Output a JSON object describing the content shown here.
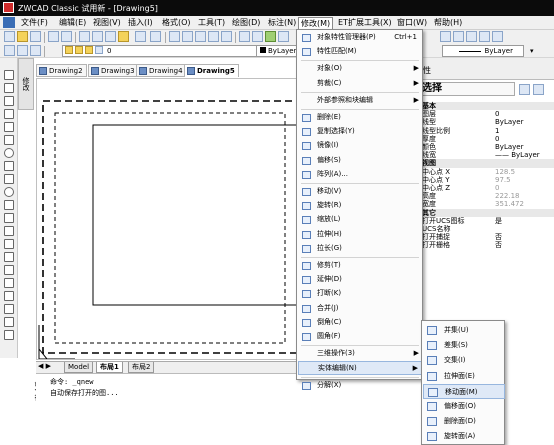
{
  "window": {
    "title": "ZWCAD Classic 试用新 - [Drawing5]"
  },
  "menubar": [
    {
      "label": "文件(F)"
    },
    {
      "label": "编辑(E)"
    },
    {
      "label": "视图(V)"
    },
    {
      "label": "插入(I)"
    },
    {
      "label": "格式(O)"
    },
    {
      "label": "工具(T)"
    },
    {
      "label": "绘图(D)"
    },
    {
      "label": "标注(N)"
    },
    {
      "label": "修改(M)"
    },
    {
      "label": "ET扩展工具(X)"
    },
    {
      "label": "窗口(W)"
    },
    {
      "label": "帮助(H)"
    }
  ],
  "toolbar": {
    "layer_value": "0",
    "color_value": "ByLayer",
    "linetype_value": "ByLayer"
  },
  "side_panel_tab": "修改",
  "doc_tabs": [
    {
      "label": "Drawing2"
    },
    {
      "label": "Drawing3"
    },
    {
      "label": "Drawing4"
    },
    {
      "label": "Drawing5"
    }
  ],
  "model_tabs": [
    {
      "label": "Model"
    },
    {
      "label": "布局1"
    },
    {
      "label": "布局2"
    }
  ],
  "command": {
    "side_label": "命令行",
    "lines": [
      "命令: _qnew",
      "自动保存打开的图..."
    ]
  },
  "properties": {
    "header": "性",
    "selection": "选择",
    "rows": [
      {
        "k": "基本",
        "v": "",
        "section": true
      },
      {
        "k": "图层",
        "v": "0"
      },
      {
        "k": "线型",
        "v": "ByLayer"
      },
      {
        "k": "线型比例",
        "v": "1"
      },
      {
        "k": "厚度",
        "v": "0"
      },
      {
        "k": "颜色",
        "v": "ByLayer"
      },
      {
        "k": "线宽",
        "v": "—— ByLayer"
      },
      {
        "k": "视图",
        "v": "",
        "section": true
      },
      {
        "k": "中心点 X",
        "v": "128.5",
        "dim": true
      },
      {
        "k": "中心点 Y",
        "v": "97.5",
        "dim": true
      },
      {
        "k": "中心点 Z",
        "v": "0",
        "dim": true
      },
      {
        "k": "高度",
        "v": "222.18",
        "dim": true
      },
      {
        "k": "宽度",
        "v": "351.472",
        "dim": true
      },
      {
        "k": "其它",
        "v": "",
        "section": true
      },
      {
        "k": "打开UCS图标",
        "v": "是"
      },
      {
        "k": "UCS名称",
        "v": ""
      },
      {
        "k": "打开捕捉",
        "v": "否"
      },
      {
        "k": "打开栅格",
        "v": "否"
      }
    ]
  },
  "modify_menu": {
    "items": [
      {
        "label": "对象特性管理器(P)",
        "shortcut": "Ctrl+1",
        "icon": "properties-icon"
      },
      {
        "label": "特性匹配(M)",
        "icon": "match-properties-icon"
      },
      {
        "sep": true
      },
      {
        "label": "对象(O)",
        "submenu": true
      },
      {
        "label": "剪裁(C)",
        "submenu": true
      },
      {
        "sep": true
      },
      {
        "label": "外部参照和块编辑",
        "submenu": true
      },
      {
        "sep": true
      },
      {
        "label": "删除(E)",
        "icon": "erase-icon"
      },
      {
        "label": "复制选择(Y)",
        "icon": "copy-icon"
      },
      {
        "label": "镜像(I)",
        "icon": "mirror-icon"
      },
      {
        "label": "偏移(S)",
        "icon": "offset-icon"
      },
      {
        "label": "阵列(A)...",
        "icon": "array-icon"
      },
      {
        "sep": true
      },
      {
        "label": "移动(V)",
        "icon": "move-icon"
      },
      {
        "label": "旋转(R)",
        "icon": "rotate-icon"
      },
      {
        "label": "缩放(L)",
        "icon": "scale-icon"
      },
      {
        "label": "拉伸(H)",
        "icon": "stretch-icon"
      },
      {
        "label": "拉长(G)",
        "icon": "lengthen-icon"
      },
      {
        "sep": true
      },
      {
        "label": "修剪(T)",
        "icon": "trim-icon"
      },
      {
        "label": "延伸(D)",
        "icon": "extend-icon"
      },
      {
        "label": "打断(K)",
        "icon": "break-icon"
      },
      {
        "label": "合并(J)",
        "icon": "join-icon"
      },
      {
        "label": "倒角(C)",
        "icon": "chamfer-icon"
      },
      {
        "label": "圆角(F)",
        "icon": "fillet-icon"
      },
      {
        "sep": true
      },
      {
        "label": "三维操作(3)",
        "submenu": true
      },
      {
        "label": "实体编辑(N)",
        "submenu": true,
        "highlight": true
      },
      {
        "sep": true
      },
      {
        "label": "分解(X)",
        "icon": "explode-icon"
      }
    ]
  },
  "solid_edit_submenu": {
    "items": [
      {
        "label": "并集(U)",
        "icon": "union-icon"
      },
      {
        "label": "差集(S)",
        "icon": "subtract-icon"
      },
      {
        "label": "交集(I)",
        "icon": "intersect-icon"
      },
      {
        "label": "拉伸面(E)",
        "icon": "extrude-face-icon"
      },
      {
        "label": "移动面(M)",
        "icon": "move-face-icon",
        "highlight": true
      },
      {
        "label": "偏移面(O)",
        "icon": "offset-face-icon"
      },
      {
        "label": "删除面(D)",
        "icon": "delete-face-icon"
      },
      {
        "label": "旋转面(A)",
        "icon": "rotate-face-icon"
      }
    ]
  }
}
